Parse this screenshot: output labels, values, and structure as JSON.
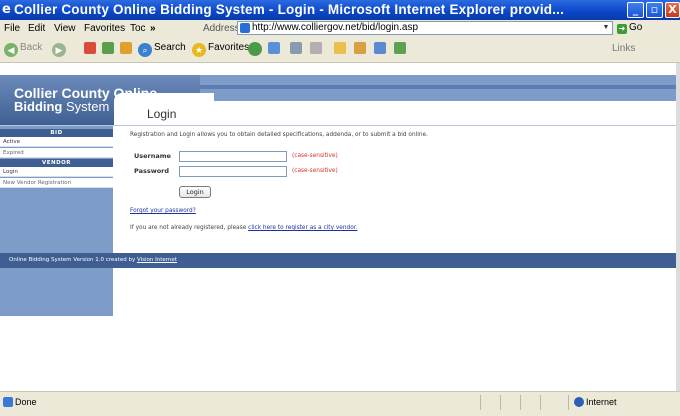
{
  "window": {
    "title": "Collier County Online Bidding System - Login - Microsoft Internet Explorer provid...",
    "min_glyph": "_",
    "max_glyph": "▫",
    "close_glyph": "X"
  },
  "menu": {
    "items": [
      "File",
      "Edit",
      "View",
      "Favorites",
      "Toc"
    ],
    "chevron": "»",
    "address_label": "Address",
    "address_url": "http://www.colliergov.net/bid/login.asp",
    "go_label": "Go"
  },
  "toolbar": {
    "back_label": "Back",
    "search_label": "Search",
    "favorites_label": "Favorites",
    "links_label": "Links"
  },
  "site": {
    "brand_line1": "Collier County Online",
    "brand_line2_bold": "Bidding",
    "brand_line2_rest": " System",
    "page_title": "Login"
  },
  "sidebar": {
    "bid_header": "BID",
    "bid_items": [
      "Active",
      "Expired"
    ],
    "vendor_header": "VENDOR",
    "vendor_items": [
      "Login",
      "New Vendor Registration"
    ]
  },
  "login": {
    "intro": "Registration and Login allows you to obtain detailed specifications, addenda, or to submit a bid online.",
    "username_label": "Username",
    "username_value": "",
    "password_label": "Password",
    "password_value": "",
    "case_note": "(case-sensitive)",
    "login_button": "Login",
    "forgot_link": "Forgot your password?",
    "register_prefix": "If you are not already registered, please ",
    "register_link": "click here to register as a city vendor."
  },
  "footer": {
    "text": "Online Bidding System Version 1.0 created by ",
    "vendor_link": "Vision Internet"
  },
  "status": {
    "left_text": "Done",
    "zone_text": "Internet"
  }
}
